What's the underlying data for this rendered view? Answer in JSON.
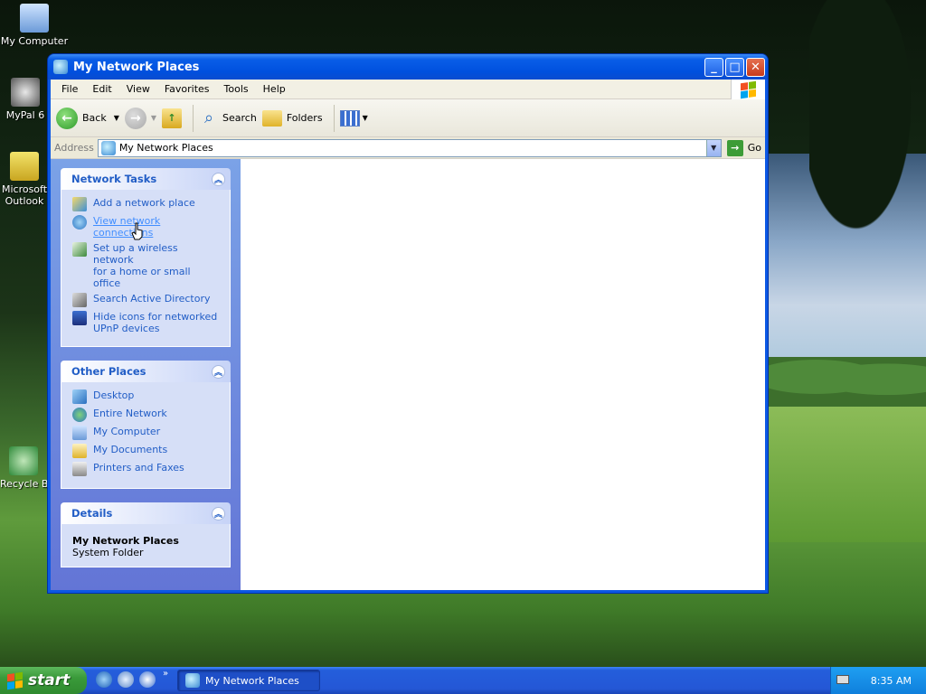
{
  "desktop": {
    "icons": [
      {
        "label": "My Computer",
        "icon": "my-computer-icon"
      },
      {
        "label": "MyPal 6",
        "icon": "mypal-icon"
      },
      {
        "label": "Microsoft Outlook",
        "icon": "outlook-icon"
      },
      {
        "label": "Recycle Bin",
        "icon": "recycle-bin-icon"
      }
    ]
  },
  "window": {
    "title": "My Network Places",
    "buttons": {
      "minimize": "_",
      "maximize": "□",
      "close": "✕"
    },
    "menu": [
      "File",
      "Edit",
      "View",
      "Favorites",
      "Tools",
      "Help"
    ],
    "toolbar": {
      "back": "Back",
      "search": "Search",
      "folders": "Folders"
    },
    "address": {
      "label": "Address",
      "value": "My Network Places",
      "go": "Go"
    },
    "taskpane": {
      "network_tasks": {
        "title": "Network Tasks",
        "items": [
          {
            "label": "Add a network place",
            "icon": "add-network-place-icon"
          },
          {
            "label": "View network connections",
            "icon": "network-connections-icon"
          },
          {
            "label": "Set up a wireless network\nfor a home or small office",
            "icon": "wireless-network-icon"
          },
          {
            "label": "Search Active Directory",
            "icon": "search-directory-icon"
          },
          {
            "label": "Hide icons for networked\nUPnP devices",
            "icon": "upnp-devices-icon"
          }
        ]
      },
      "other_places": {
        "title": "Other Places",
        "items": [
          {
            "label": "Desktop",
            "icon": "desktop-icon"
          },
          {
            "label": "Entire Network",
            "icon": "entire-network-icon"
          },
          {
            "label": "My Computer",
            "icon": "my-computer-icon"
          },
          {
            "label": "My Documents",
            "icon": "my-documents-icon"
          },
          {
            "label": "Printers and Faxes",
            "icon": "printer-icon"
          }
        ]
      },
      "details": {
        "title": "Details",
        "name": "My Network Places",
        "type": "System Folder"
      }
    }
  },
  "taskbar": {
    "start": "start",
    "task_item": "My Network Places",
    "clock": "8:35 AM"
  },
  "colors": {
    "xp_blue": "#0b58e4",
    "task_link": "#215dc6",
    "start_green": "#3a9a3a"
  }
}
